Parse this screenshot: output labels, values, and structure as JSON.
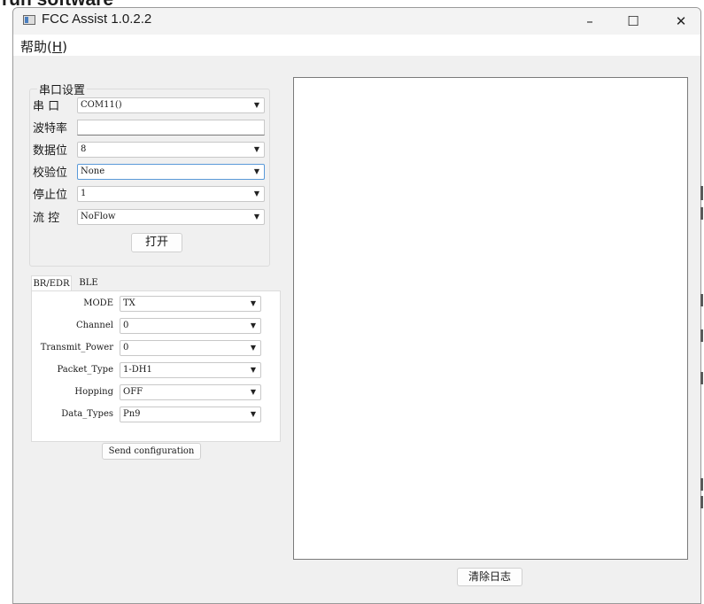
{
  "window": {
    "title": "FCC Assist 1.0.2.2"
  },
  "titlebar_buttons": {
    "minimize": "–",
    "maximize": "☐",
    "close": "✕"
  },
  "menu": {
    "help_label": "帮助(",
    "help_accel": "H",
    "help_close": ")"
  },
  "serial": {
    "legend": "串口设置",
    "port_label": "串 口",
    "port_value": "COM11()",
    "baud_label": "波特率",
    "baud_value": "",
    "databits_label": "数据位",
    "databits_value": "8",
    "parity_label": "校验位",
    "parity_value": "None",
    "stopbits_label": "停止位",
    "stopbits_value": "1",
    "flow_label": "流 控",
    "flow_value": "NoFlow",
    "open_button": "打开"
  },
  "tabs": [
    {
      "label": "BR/EDR",
      "active": true
    },
    {
      "label": "BLE",
      "active": false
    }
  ],
  "config": {
    "mode_label": "MODE",
    "mode_value": "TX",
    "channel_label": "Channel",
    "channel_value": "0",
    "power_label": "Transmit_Power",
    "power_value": "0",
    "packet_label": "Packet_Type",
    "packet_value": "1-DH1",
    "hopping_label": "Hopping",
    "hopping_value": "OFF",
    "datatypes_label": "Data_Types",
    "datatypes_value": "Pn9"
  },
  "send_button": "Send configuration",
  "log": {
    "content": ""
  },
  "clear_log_button": "清除日志",
  "clipped_header_text": "run software",
  "icons": {
    "dropdown_arrow": "▼"
  }
}
